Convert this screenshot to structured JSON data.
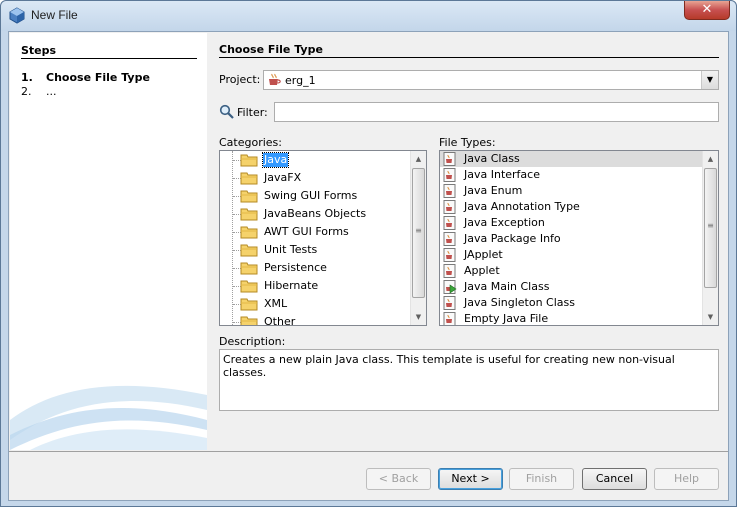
{
  "window": {
    "title": "New File",
    "close_label": "✕"
  },
  "steps": {
    "title": "Steps",
    "items": [
      {
        "num": "1.",
        "label": "Choose File Type"
      },
      {
        "num": "2.",
        "label": "..."
      }
    ]
  },
  "main": {
    "section_title": "Choose File Type",
    "project_label": "Project:",
    "project_value": "erg_1",
    "filter_label": "Filter:",
    "filter_value": "",
    "categories_label": "Categories:",
    "file_types_label": "File Types:",
    "categories": [
      {
        "label": "Java",
        "selected": true
      },
      {
        "label": "JavaFX"
      },
      {
        "label": "Swing GUI Forms"
      },
      {
        "label": "JavaBeans Objects"
      },
      {
        "label": "AWT GUI Forms"
      },
      {
        "label": "Unit Tests"
      },
      {
        "label": "Persistence"
      },
      {
        "label": "Hibernate"
      },
      {
        "label": "XML"
      },
      {
        "label": "Other"
      }
    ],
    "file_types": [
      {
        "label": "Java Class",
        "selected": true,
        "icon": "java-class-icon"
      },
      {
        "label": "Java Interface",
        "icon": "java-class-icon"
      },
      {
        "label": "Java Enum",
        "icon": "java-class-icon"
      },
      {
        "label": "Java Annotation Type",
        "icon": "java-class-icon"
      },
      {
        "label": "Java Exception",
        "icon": "java-class-icon"
      },
      {
        "label": "Java Package Info",
        "icon": "java-class-icon"
      },
      {
        "label": "JApplet",
        "icon": "java-class-icon"
      },
      {
        "label": "Applet",
        "icon": "java-class-icon"
      },
      {
        "label": "Java Main Class",
        "icon": "java-main-class-icon"
      },
      {
        "label": "Java Singleton Class",
        "icon": "java-class-icon"
      },
      {
        "label": "Empty Java File",
        "icon": "java-class-icon"
      }
    ],
    "description_label": "Description:",
    "description": "Creates a new plain Java class. This template is useful for creating new non-visual classes."
  },
  "buttons": {
    "back": "< Back",
    "next": "Next >",
    "finish": "Finish",
    "cancel": "Cancel",
    "help": "Help"
  },
  "colors": {
    "selection": "#3399ff",
    "frame": "#c5d7ea"
  }
}
